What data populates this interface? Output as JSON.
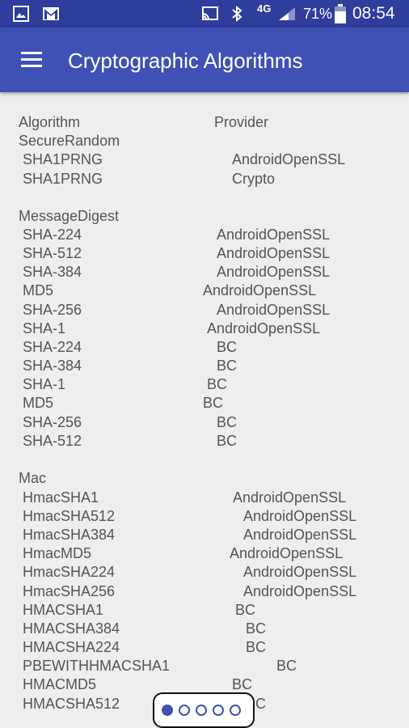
{
  "status_bar": {
    "network": "4G",
    "battery": "71%",
    "time": "08:54"
  },
  "app_bar": {
    "title": "Cryptographic Algorithms"
  },
  "table": {
    "header": {
      "algorithm": "Algorithm",
      "provider": "Provider"
    },
    "sections": [
      {
        "name": "SecureRandom",
        "rows": [
          {
            "algorithm": "SHA1PRNG",
            "provider": "AndroidOpenSSL"
          },
          {
            "algorithm": "SHA1PRNG",
            "provider": "Crypto"
          }
        ]
      },
      {
        "name": "MessageDigest",
        "rows": [
          {
            "algorithm": "SHA-224",
            "provider": "AndroidOpenSSL"
          },
          {
            "algorithm": "SHA-512",
            "provider": "AndroidOpenSSL"
          },
          {
            "algorithm": "SHA-384",
            "provider": "AndroidOpenSSL"
          },
          {
            "algorithm": "MD5",
            "provider": "AndroidOpenSSL"
          },
          {
            "algorithm": "SHA-256",
            "provider": "AndroidOpenSSL"
          },
          {
            "algorithm": "SHA-1",
            "provider": "AndroidOpenSSL"
          },
          {
            "algorithm": "SHA-224",
            "provider": "BC"
          },
          {
            "algorithm": "SHA-384",
            "provider": "BC"
          },
          {
            "algorithm": "SHA-1",
            "provider": "BC"
          },
          {
            "algorithm": "MD5",
            "provider": "BC"
          },
          {
            "algorithm": "SHA-256",
            "provider": "BC"
          },
          {
            "algorithm": "SHA-512",
            "provider": "BC"
          }
        ]
      },
      {
        "name": "Mac",
        "rows": [
          {
            "algorithm": "HmacSHA1",
            "provider": "AndroidOpenSSL"
          },
          {
            "algorithm": "HmacSHA512",
            "provider": "AndroidOpenSSL"
          },
          {
            "algorithm": "HmacSHA384",
            "provider": "AndroidOpenSSL"
          },
          {
            "algorithm": "HmacMD5",
            "provider": "AndroidOpenSSL"
          },
          {
            "algorithm": "HmacSHA224",
            "provider": "AndroidOpenSSL"
          },
          {
            "algorithm": "HmacSHA256",
            "provider": "AndroidOpenSSL"
          },
          {
            "algorithm": "HMACSHA1",
            "provider": "BC"
          },
          {
            "algorithm": "HMACSHA384",
            "provider": "BC"
          },
          {
            "algorithm": "HMACSHA224",
            "provider": "BC"
          },
          {
            "algorithm": "PBEWITHHMACSHA1",
            "provider": "BC"
          },
          {
            "algorithm": "HMACMD5",
            "provider": "BC"
          },
          {
            "algorithm": "HMACSHA512",
            "provider": "BC"
          }
        ]
      }
    ]
  },
  "pager": {
    "page_count": 5,
    "active_index": 0
  }
}
